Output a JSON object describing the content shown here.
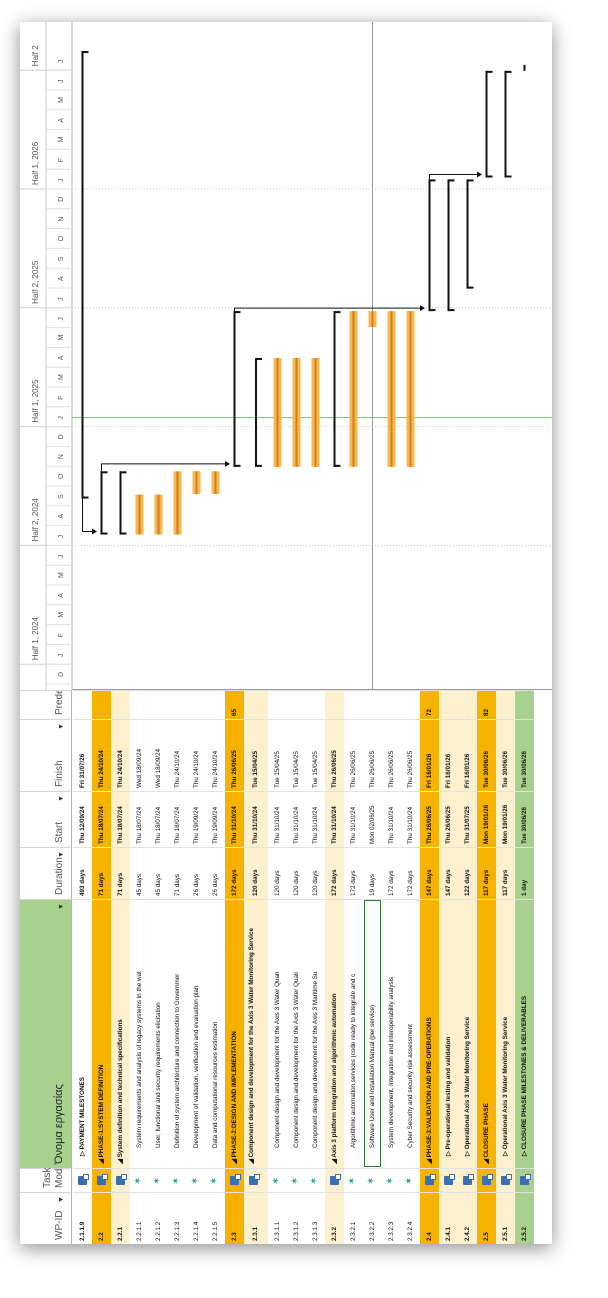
{
  "columns": {
    "wpid": "WP-ID",
    "mode_line1": "Task",
    "mode_line2": "Mode",
    "name": "Όνομα εργασίας",
    "duration": "Duration",
    "start": "Start",
    "finish": "Finish",
    "pred": "Predecessors"
  },
  "timescale": {
    "halves": [
      "Half 1, 2024",
      "Half 2, 2024",
      "Half 1, 2025",
      "Half 2, 2025",
      "Half 1, 2026",
      "Half 2"
    ],
    "months": [
      "D",
      "J",
      "F",
      "M",
      "A",
      "M",
      "J",
      "J",
      "A",
      "S",
      "O",
      "N",
      "D",
      "J",
      "F",
      "M",
      "A",
      "M",
      "J",
      "J",
      "A",
      "S",
      "O",
      "N",
      "D",
      "J",
      "F",
      "M",
      "A",
      "M",
      "J",
      "J"
    ]
  },
  "rows": [
    {
      "id": "2.1.1.9",
      "mode": "auto",
      "name": "▷ PAYMENT MILESTONES",
      "indent": 1,
      "dur": "493 days",
      "start": "Thu 12/09/24",
      "finish": "Fri 31/07/26",
      "pred": "",
      "style": "plain",
      "bold": true
    },
    {
      "id": "2.2",
      "mode": "auto",
      "name": "◢ PHASE-1:SYSTEM DEFINITION",
      "indent": 0,
      "dur": "71 days",
      "start": "Thu 18/07/24",
      "finish": "Thu 24/10/24",
      "pred": "",
      "style": "orange",
      "bold": true
    },
    {
      "id": "2.2.1",
      "mode": "auto",
      "name": "◢ System definition and technical specifications",
      "indent": 0,
      "dur": "71 days",
      "start": "Thu 18/07/24",
      "finish": "Thu 24/10/24",
      "pred": "",
      "style": "cream",
      "bold": true
    },
    {
      "id": "2.2.1.1",
      "mode": "manual",
      "name": "System requirements and analysis of legacy systems in the wat",
      "indent": 2,
      "dur": "45 days",
      "start": "Thu 18/07/24",
      "finish": "Wed 18/09/24",
      "pred": "",
      "style": "plain",
      "bold": false
    },
    {
      "id": "2.2.1.2",
      "mode": "manual",
      "name": "User, functional and security requirements elicitation",
      "indent": 2,
      "dur": "45 days",
      "start": "Thu 18/07/24",
      "finish": "Wed 18/09/24",
      "pred": "",
      "style": "plain",
      "bold": false
    },
    {
      "id": "2.2.1.3",
      "mode": "manual",
      "name": "Definition of system architecture and connection to Governmer",
      "indent": 2,
      "dur": "71 days",
      "start": "Thu 18/07/24",
      "finish": "Thu 24/10/24",
      "pred": "",
      "style": "plain",
      "bold": false
    },
    {
      "id": "2.2.1.4",
      "mode": "manual",
      "name": "Development of validation, verification and evaluation plan",
      "indent": 2,
      "dur": "26 days",
      "start": "Thu 19/09/24",
      "finish": "Thu 24/10/24",
      "pred": "",
      "style": "plain",
      "bold": false
    },
    {
      "id": "2.2.1.5",
      "mode": "manual",
      "name": "Data and computational resources estimation",
      "indent": 2,
      "dur": "26 days",
      "start": "Thu 19/09/24",
      "finish": "Thu 24/10/24",
      "pred": "",
      "style": "plain",
      "bold": false
    },
    {
      "id": "2.3",
      "mode": "auto",
      "name": "◢ PHASE-2:DESIGN AND IMPLEMENTATION",
      "indent": 0,
      "dur": "172 days",
      "start": "Thu 31/10/24",
      "finish": "Thu 26/06/25",
      "pred": "65",
      "style": "orange",
      "bold": true
    },
    {
      "id": "2.3.1",
      "mode": "auto",
      "name": "◢ Component design and development for the Axis 3 Water Monitoring Service",
      "indent": 0,
      "dur": "120 days",
      "start": "Thu 31/10/24",
      "finish": "Tue 15/04/25",
      "pred": "",
      "style": "cream",
      "bold": true,
      "tall": true
    },
    {
      "id": "2.3.1.1",
      "mode": "manual",
      "name": "Component design and development for the Axis 3 Water Quan",
      "indent": 2,
      "dur": "120 days",
      "start": "Thu 31/10/24",
      "finish": "Tue 15/04/25",
      "pred": "",
      "style": "plain",
      "bold": false
    },
    {
      "id": "2.3.1.2",
      "mode": "manual",
      "name": "Component design and development for the Axis 3 Water Quali",
      "indent": 2,
      "dur": "120 days",
      "start": "Thu 31/10/24",
      "finish": "Tue 15/04/25",
      "pred": "",
      "style": "plain",
      "bold": false
    },
    {
      "id": "2.3.1.3",
      "mode": "manual",
      "name": "Component design and development for the Axis 3 Maritime Su",
      "indent": 2,
      "dur": "120 days",
      "start": "Thu 31/10/24",
      "finish": "Tue 15/04/25",
      "pred": "",
      "style": "plain",
      "bold": false
    },
    {
      "id": "2.3.2",
      "mode": "auto",
      "name": "◢ Axis 3 platform integration and algorithmic automation",
      "indent": 0,
      "dur": "172 days",
      "start": "Thu 31/10/24",
      "finish": "Thu 26/06/25",
      "pred": "",
      "style": "cream",
      "bold": true
    },
    {
      "id": "2.3.2.1",
      "mode": "manual",
      "name": "Algorithmic automation services (code ready to integrate and c",
      "indent": 2,
      "dur": "172 days",
      "start": "Thu 31/10/24",
      "finish": "Thu 26/06/25",
      "pred": "",
      "style": "plain",
      "bold": false
    },
    {
      "id": "2.3.2.2",
      "mode": "manual",
      "name": "Software User and Installation Manual (per service)",
      "indent": 2,
      "dur": "19 days",
      "start": "Mon 02/06/25",
      "finish": "Thu 26/06/25",
      "pred": "",
      "style": "plain",
      "bold": false,
      "selected": true
    },
    {
      "id": "2.3.2.3",
      "mode": "manual",
      "name": "System development, integration and interoperability analysis",
      "indent": 2,
      "dur": "172 days",
      "start": "Thu 31/10/24",
      "finish": "Thu 26/06/25",
      "pred": "",
      "style": "plain",
      "bold": false
    },
    {
      "id": "2.3.2.4",
      "mode": "manual",
      "name": "Cyber Security and security risk assessment",
      "indent": 2,
      "dur": "172 days",
      "start": "Thu 31/10/24",
      "finish": "Thu 26/06/25",
      "pred": "",
      "style": "plain",
      "bold": false
    },
    {
      "id": "2.4",
      "mode": "auto",
      "name": "◢ PHASE-3:VALIDATION AND PRE-OPERATIONS",
      "indent": 0,
      "dur": "147 days",
      "start": "Thu 26/06/25",
      "finish": "Fri 16/01/26",
      "pred": "72",
      "style": "orange",
      "bold": true
    },
    {
      "id": "2.4.1",
      "mode": "auto",
      "name": "▷ Pre-operational testing and validation",
      "indent": 1,
      "dur": "147 days",
      "start": "Thu 26/06/25",
      "finish": "Fri 16/01/26",
      "pred": "",
      "style": "cream",
      "bold": true
    },
    {
      "id": "2.4.2",
      "mode": "auto",
      "name": "▷ Operational Axis 3 Water Monitoring Service",
      "indent": 1,
      "dur": "122 days",
      "start": "Thu 31/07/25",
      "finish": "Fri 16/01/26",
      "pred": "",
      "style": "cream",
      "bold": true
    },
    {
      "id": "2.5",
      "mode": "auto",
      "name": "◢ CLOSURE PHASE",
      "indent": 0,
      "dur": "117 days",
      "start": "Mon 19/01/26",
      "finish": "Tue 30/06/26",
      "pred": "82",
      "style": "orange",
      "bold": true
    },
    {
      "id": "2.5.1",
      "mode": "auto",
      "name": "▷ Operational Axis 3 Water Monitoring Service",
      "indent": 1,
      "dur": "117 days",
      "start": "Mon 19/01/26",
      "finish": "Tue 30/06/26",
      "pred": "",
      "style": "cream",
      "bold": true
    },
    {
      "id": "2.5.2",
      "mode": "auto",
      "name": "▷ CLOSURE PHASE MILESTONES & DELIVERABLES",
      "indent": 1,
      "dur": "1 day",
      "start": "Tue 30/06/26",
      "finish": "Tue 30/06/26",
      "pred": "",
      "style": "green",
      "bold": true
    }
  ],
  "colors": {
    "orange": "#f7b200",
    "cream": "#fdf0cf",
    "green": "#a9d18e",
    "header_name": "#a9d18e",
    "bar": "#f5b94a",
    "bar_dark": "#d9792e",
    "today_line": "#7cb97a"
  }
}
